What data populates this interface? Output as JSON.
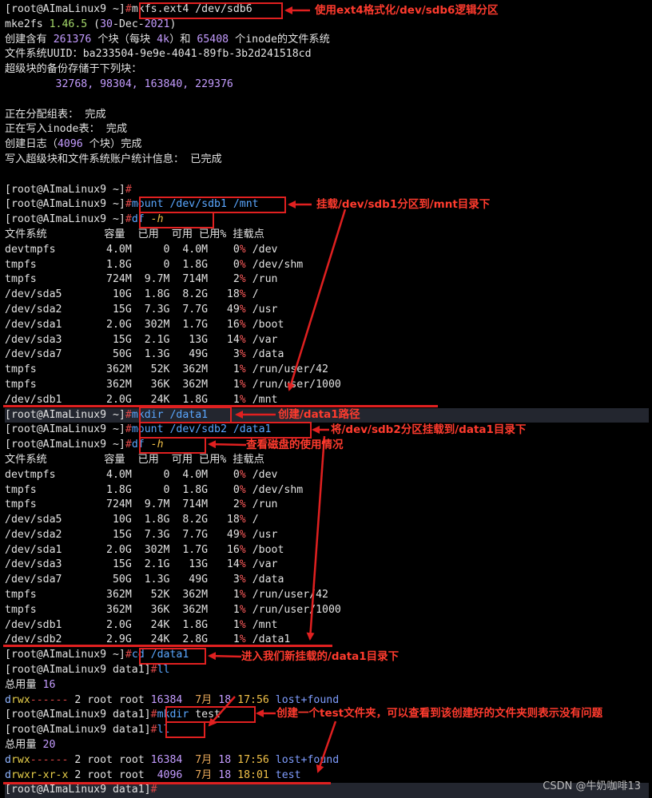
{
  "prompt_home": "[root@AImaLinux9 ~]",
  "prompt_data1": "[root@AImaLinux9 data1]",
  "hash": "#",
  "commands": {
    "mkfs": "mkfs.ext4 /dev/sdb6",
    "mount1": "mount /dev/sdb1 /mnt",
    "df_cmd": "df",
    "df_flag": "-h",
    "mkdir": "mkdir /data1",
    "mount2": "mount /dev/sdb2 /data1",
    "cd": "cd /data1",
    "ll": "ll",
    "mkdir_test_cmd": "mkdir",
    "mkdir_test_arg": "test"
  },
  "mkfs_output": {
    "l1_a": "mke2fs ",
    "l1_ver": "1.46.5",
    "l1_b": " (",
    "l1_num": "30",
    "l1_c": "-Dec-",
    "l1_year": "2021",
    "l1_d": ")",
    "l2_a": "创建含有 ",
    "l2_blocks": "261376",
    "l2_b": " 个块（每块 ",
    "l2_bs": "4k",
    "l2_c": "）和 ",
    "l2_inodes": "65408",
    "l2_d": " 个inode的文件系统",
    "l3": "文件系统UUID：ba233504-9e9e-4041-89fb-3b2d241518cd",
    "l4": "超级块的备份存储于下列块：",
    "l5": "        32768, 98304, 163840, 229376",
    "l6": "正在分配组表： 完成",
    "l7": "正在写入inode表： 完成",
    "l8_a": "创建日志（",
    "l8_num": "4096",
    "l8_b": " 个块）完成",
    "l9": "写入超级块和文件系统账户统计信息： 已完成"
  },
  "df_header": "文件系统         容量  已用  可用 已用% 挂载点",
  "df1_rows": [
    {
      "fs": "devtmpfs        ",
      "size": "4.0M",
      "used": "     0",
      "avail": "  4.0M",
      "pct": "    0",
      "mount": "/dev"
    },
    {
      "fs": "tmpfs           ",
      "size": "1.8G",
      "used": "     0",
      "avail": "  1.8G",
      "pct": "    0",
      "mount": "/dev/shm"
    },
    {
      "fs": "tmpfs           ",
      "size": "724M",
      "used": "  9.7M",
      "avail": "  714M",
      "pct": "    2",
      "mount": "/run"
    },
    {
      "fs": "/dev/sda5       ",
      "size": " 10G",
      "used": "  1.8G",
      "avail": "  8.2G",
      "pct": "   18",
      "mount": "/"
    },
    {
      "fs": "/dev/sda2       ",
      "size": " 15G",
      "used": "  7.3G",
      "avail": "  7.7G",
      "pct": "   49",
      "mount": "/usr"
    },
    {
      "fs": "/dev/sda1       ",
      "size": "2.0G",
      "used": "  302M",
      "avail": "  1.7G",
      "pct": "   16",
      "mount": "/boot"
    },
    {
      "fs": "/dev/sda3       ",
      "size": " 15G",
      "used": "  2.1G",
      "avail": "   13G",
      "pct": "   14",
      "mount": "/var"
    },
    {
      "fs": "/dev/sda7       ",
      "size": " 50G",
      "used": "  1.3G",
      "avail": "   49G",
      "pct": "    3",
      "mount": "/data"
    },
    {
      "fs": "tmpfs           ",
      "size": "362M",
      "used": "   52K",
      "avail": "  362M",
      "pct": "    1",
      "mount": "/run/user/42"
    },
    {
      "fs": "tmpfs           ",
      "size": "362M",
      "used": "   36K",
      "avail": "  362M",
      "pct": "    1",
      "mount": "/run/user/1000"
    },
    {
      "fs": "/dev/sdb1       ",
      "size": "2.0G",
      "used": "   24K",
      "avail": "  1.8G",
      "pct": "    1",
      "mount": "/mnt"
    }
  ],
  "df2_rows": [
    {
      "fs": "devtmpfs        ",
      "size": "4.0M",
      "used": "     0",
      "avail": "  4.0M",
      "pct": "    0",
      "mount": "/dev"
    },
    {
      "fs": "tmpfs           ",
      "size": "1.8G",
      "used": "     0",
      "avail": "  1.8G",
      "pct": "    0",
      "mount": "/dev/shm"
    },
    {
      "fs": "tmpfs           ",
      "size": "724M",
      "used": "  9.7M",
      "avail": "  714M",
      "pct": "    2",
      "mount": "/run"
    },
    {
      "fs": "/dev/sda5       ",
      "size": " 10G",
      "used": "  1.8G",
      "avail": "  8.2G",
      "pct": "   18",
      "mount": "/"
    },
    {
      "fs": "/dev/sda2       ",
      "size": " 15G",
      "used": "  7.3G",
      "avail": "  7.7G",
      "pct": "   49",
      "mount": "/usr"
    },
    {
      "fs": "/dev/sda1       ",
      "size": "2.0G",
      "used": "  302M",
      "avail": "  1.7G",
      "pct": "   16",
      "mount": "/boot"
    },
    {
      "fs": "/dev/sda3       ",
      "size": " 15G",
      "used": "  2.1G",
      "avail": "   13G",
      "pct": "   14",
      "mount": "/var"
    },
    {
      "fs": "/dev/sda7       ",
      "size": " 50G",
      "used": "  1.3G",
      "avail": "   49G",
      "pct": "    3",
      "mount": "/data"
    },
    {
      "fs": "tmpfs           ",
      "size": "362M",
      "used": "   52K",
      "avail": "  362M",
      "pct": "    1",
      "mount": "/run/user/42"
    },
    {
      "fs": "tmpfs           ",
      "size": "362M",
      "used": "   36K",
      "avail": "  362M",
      "pct": "    1",
      "mount": "/run/user/1000"
    },
    {
      "fs": "/dev/sdb1       ",
      "size": "2.0G",
      "used": "   24K",
      "avail": "  1.8G",
      "pct": "    1",
      "mount": "/mnt"
    },
    {
      "fs": "/dev/sdb2       ",
      "size": "2.9G",
      "used": "   24K",
      "avail": "  2.8G",
      "pct": "    1",
      "mount": "/data1"
    }
  ],
  "pct_sign": "%",
  "ll1": {
    "total_label": "总用量 ",
    "total": "16",
    "rows": [
      {
        "perm": [
          "d",
          "rwx",
          "------"
        ],
        "rest": " 2 root root ",
        "size": "16384",
        "mon": "  7月",
        "day": " 18",
        "time": " 17:56",
        "name": " lost+found"
      }
    ]
  },
  "ll2": {
    "total_label": "总用量 ",
    "total": "20",
    "rows": [
      {
        "perm": [
          "d",
          "rwx",
          "------"
        ],
        "rest": " 2 root root ",
        "size": "16384",
        "mon": "  7月",
        "day": " 18",
        "time": " 17:56",
        "name": " lost+found"
      },
      {
        "perm": [
          "d",
          "rwxr-xr-x",
          ""
        ],
        "rest": " 2 root root  ",
        "size": "4096",
        "mon": "  7月",
        "day": " 18",
        "time": " 18:01",
        "name": " test"
      }
    ]
  },
  "annotations": {
    "a1": "使用ext4格式化/dev/sdb6逻辑分区",
    "a2": "挂载/dev/sdb1分区到/mnt目录下",
    "a3": "创建/data1路径",
    "a4": "将/dev/sdb2分区挂载到/data1目录下",
    "a5": "查看磁盘的使用情况",
    "a6": "进入我们新挂载的/data1目录下",
    "a7": "创建一个test文件夹，可以查看到该创建好的文件夹则表示没有问题"
  },
  "watermark": "CSDN @牛奶咖啡13",
  "colors": {
    "annotation": "#e02020",
    "prompt_hash": "#e04848",
    "cmd_blue": "#5aa7ff"
  }
}
